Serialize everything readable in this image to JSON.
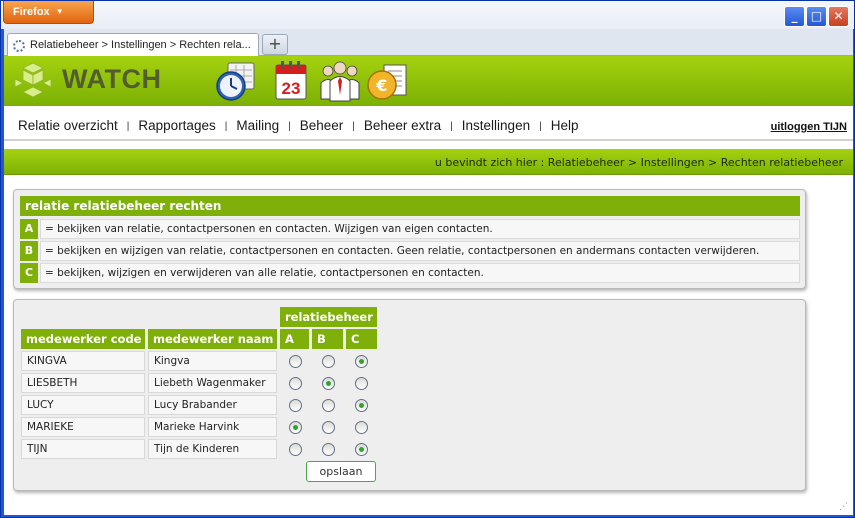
{
  "browser": {
    "menu_label": "Firefox",
    "tab_title": "Relatiebeheer > Instellingen > Rechten rela...",
    "new_tab_label": "+",
    "controls": {
      "minimize": "_",
      "maximize": "□",
      "close": "✕"
    }
  },
  "header": {
    "logo_text": "WATCH",
    "icons": [
      "clock-icon",
      "calendar-icon",
      "people-icon",
      "euro-invoice-icon"
    ],
    "calendar_day": "23"
  },
  "nav": {
    "items": [
      "Relatie overzicht",
      "Rapportages",
      "Mailing",
      "Beheer",
      "Beheer extra",
      "Instellingen",
      "Help"
    ],
    "separator": "|",
    "logout": "uitloggen TIJN"
  },
  "breadcrumb": "u bevindt zich hier : Relatiebeheer > Instellingen > Rechten relatiebeheer",
  "legend": {
    "title": "relatie relatiebeheer rechten",
    "rows": [
      {
        "key": "A",
        "text": "= bekijken van relatie, contactpersonen en contacten. Wijzigen van eigen contacten."
      },
      {
        "key": "B",
        "text": "= bekijken en wijzigen van relatie, contactpersonen en contacten. Geen relatie, contactpersonen en andermans contacten verwijderen."
      },
      {
        "key": "C",
        "text": "= bekijken, wijzigen en verwijderen van alle relatie, contactpersonen en contacten."
      }
    ]
  },
  "grid": {
    "group_header": "relatiebeheer",
    "col_code": "medewerker code",
    "col_name": "medewerker naam",
    "levels": [
      "A",
      "B",
      "C"
    ],
    "rows": [
      {
        "code": "KINGVA",
        "name": "Kingva",
        "selected": "C"
      },
      {
        "code": "LIESBETH",
        "name": "Liebeth Wagenmaker",
        "selected": "B"
      },
      {
        "code": "LUCY",
        "name": "Lucy Brabander",
        "selected": "C"
      },
      {
        "code": "MARIEKE",
        "name": "Marieke Harvink",
        "selected": "A"
      },
      {
        "code": "TIJN",
        "name": "Tijn de Kinderen",
        "selected": "C"
      }
    ],
    "save_label": "opslaan"
  },
  "colors": {
    "accent_green": "#7fb009",
    "header_green": "#a5d20f",
    "xp_blue": "#1c57d4",
    "firefox_orange": "#e0640f"
  }
}
